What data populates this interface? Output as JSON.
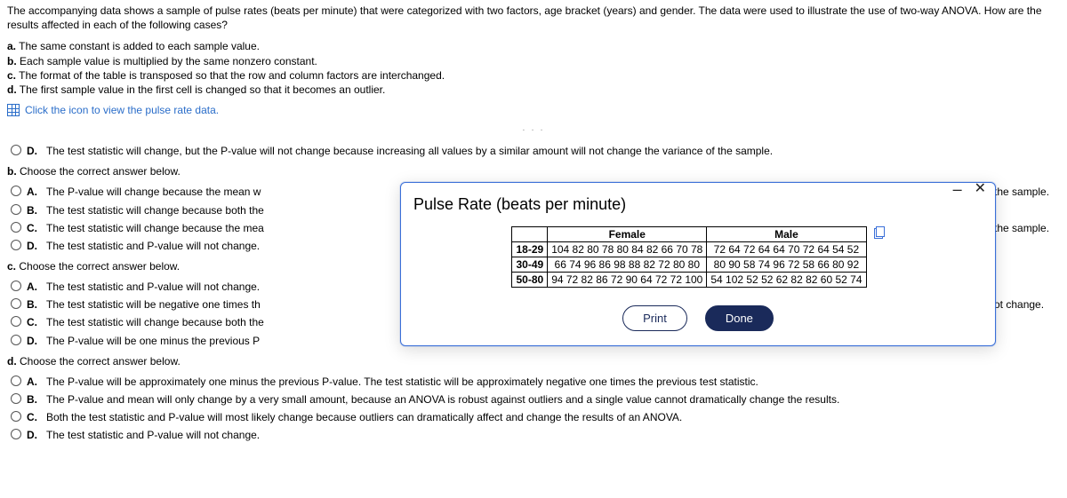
{
  "intro": "The accompanying data shows a sample of pulse rates (beats per minute) that were categorized with two factors, age bracket (years) and gender. The data were used to illustrate the use of two-way ANOVA. How are the results affected in each of the following cases?",
  "subparts": {
    "a": "The same constant is added to each sample value.",
    "b": "Each sample value is multiplied by the same nonzero constant.",
    "c": "The format of the table is transposed so that the row and column factors are interchanged.",
    "d": "The first sample value in the first cell is changed so that it becomes an outlier."
  },
  "data_link": "Click the icon to view the pulse rate data.",
  "dots": "· · ·",
  "visible_option_d_above": "The test statistic will change, but the P-value will not change because increasing all values by a similar amount will not change the variance of the sample.",
  "b_prompt": "Choose the correct answer below.",
  "b_options": {
    "A": {
      "left": "The P-value will change because the mean w",
      "right": " the sample."
    },
    "B": {
      "left": "The test statistic will change because both the",
      "right": ""
    },
    "C": {
      "left": "The test statistic will change because the mea",
      "right": " the sample."
    },
    "D": {
      "left": "The test statistic and P-value will not change.",
      "right": ""
    }
  },
  "c_prompt": "Choose the correct answer below.",
  "c_options": {
    "A": "The test statistic and P-value will not change.",
    "B": {
      "left": "The test statistic will be negative one times th",
      "right": "ot change."
    },
    "C": "The test statistic will change because both the",
    "D": "The P-value will be one minus the previous P"
  },
  "d_prompt": "Choose the correct answer below.",
  "d_options": {
    "A": "The P-value will be approximately one minus the previous P-value. The test statistic will be approximately negative one times the previous test statistic.",
    "B": "The P-value and mean will only change by a very small amount, because an ANOVA is robust against outliers and a single value cannot dramatically change the results.",
    "C": "Both the test statistic and P-value will most likely change because outliers can dramatically affect and change the results of an ANOVA.",
    "D": "The test statistic and P-value will not change."
  },
  "modal": {
    "title": "Pulse Rate (beats per minute)",
    "minimize": "–",
    "close": "✕",
    "col_female": "Female",
    "col_male": "Male",
    "rows": {
      "r1": {
        "hdr": "18-29",
        "female": "104  82  80  78  80  84  82  66  70  78",
        "male": "72  64  72  64  64  70  72  64  54  52"
      },
      "r2": {
        "hdr": "30-49",
        "female": "66  74  96  86  98  88  82  72  80  80",
        "male": "80  90  58  74  96  72  58  66  80  92"
      },
      "r3": {
        "hdr": "50-80",
        "female": "94  72  82  86  72  90  64  72  72  100",
        "male": "54  102  52  52  62  82  82  60  52  74"
      }
    },
    "print": "Print",
    "done": "Done"
  },
  "letters": {
    "A": "A.",
    "B": "B.",
    "C": "C.",
    "D": "D."
  },
  "sub_labels": {
    "a": "a.",
    "b": "b.",
    "c": "c.",
    "d": "d."
  },
  "chart_data": {
    "type": "table",
    "title": "Pulse Rate (beats per minute)",
    "row_factor": "Age bracket (years)",
    "col_factor": "Gender",
    "row_levels": [
      "18-29",
      "30-49",
      "50-80"
    ],
    "col_levels": [
      "Female",
      "Male"
    ],
    "data": {
      "18-29": {
        "Female": [
          104,
          82,
          80,
          78,
          80,
          84,
          82,
          66,
          70,
          78
        ],
        "Male": [
          72,
          64,
          72,
          64,
          64,
          70,
          72,
          64,
          54,
          52
        ]
      },
      "30-49": {
        "Female": [
          66,
          74,
          96,
          86,
          98,
          88,
          82,
          72,
          80,
          80
        ],
        "Male": [
          80,
          90,
          58,
          74,
          96,
          72,
          58,
          66,
          80,
          92
        ]
      },
      "50-80": {
        "Female": [
          94,
          72,
          82,
          86,
          72,
          90,
          64,
          72,
          72,
          100
        ],
        "Male": [
          54,
          102,
          52,
          52,
          62,
          82,
          82,
          60,
          52,
          74
        ]
      }
    }
  }
}
